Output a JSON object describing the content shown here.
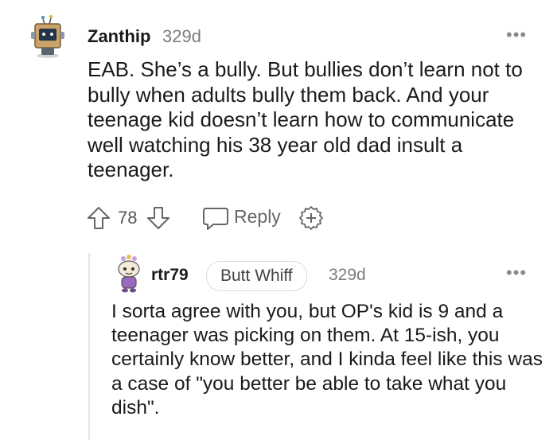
{
  "comments": [
    {
      "username": "Zanthip",
      "time": "329d",
      "body": "EAB. She’s a bully. But bullies don’t learn not to bully when adults bully them back. And your teenage kid doesn’t learn how to communicate well watching his 38 year old dad insult a teenager.",
      "votes": "78",
      "reply_label": "Reply",
      "more": "•••",
      "avatar_icon": "robot-avatar-icon"
    },
    {
      "username": "rtr79",
      "flair": "Butt Whiff",
      "time": "329d",
      "body": "I sorta agree with you, but OP's kid is 9 and a teenager was picking on them. At 15-ish, you certainly know better, and I kinda feel like this was a case of \"you better be able to take what you dish\".",
      "more": "•••",
      "avatar_icon": "snoo-avatar-icon"
    }
  ],
  "colors": {
    "text": "#1a1a1b",
    "meta": "#7c7c7c",
    "thread_line": "#e4e6e8"
  }
}
